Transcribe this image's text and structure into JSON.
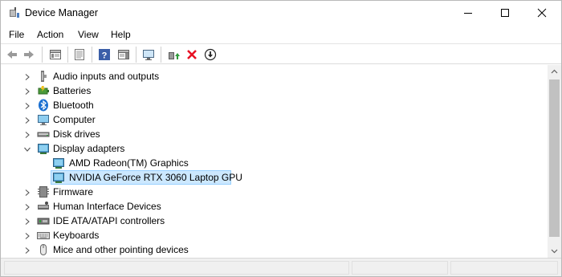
{
  "window": {
    "title": "Device Manager"
  },
  "menu": [
    "File",
    "Action",
    "View",
    "Help"
  ],
  "toolbar": {
    "buttons": [
      "back-icon",
      "forward-icon",
      "console-tree-icon",
      "properties-icon",
      "help-icon",
      "action-pane-icon",
      "monitor-icon",
      "update-driver-icon",
      "uninstall-device-icon",
      "download-icon"
    ]
  },
  "tree": {
    "items": [
      {
        "label": "Audio inputs and outputs",
        "icon": "speaker-icon",
        "level": 1,
        "expander": "collapsed"
      },
      {
        "label": "Batteries",
        "icon": "battery-icon",
        "level": 1,
        "expander": "collapsed"
      },
      {
        "label": "Bluetooth",
        "icon": "bluetooth-icon",
        "level": 1,
        "expander": "collapsed"
      },
      {
        "label": "Computer",
        "icon": "computer-icon",
        "level": 1,
        "expander": "collapsed"
      },
      {
        "label": "Disk drives",
        "icon": "disk-drive-icon",
        "level": 1,
        "expander": "collapsed"
      },
      {
        "label": "Display adapters",
        "icon": "display-adapter-icon",
        "level": 1,
        "expander": "expanded"
      },
      {
        "label": "AMD Radeon(TM) Graphics",
        "icon": "display-adapter-icon",
        "level": 2,
        "expander": "none"
      },
      {
        "label": "NVIDIA GeForce RTX 3060 Laptop GPU",
        "icon": "display-adapter-icon",
        "level": 2,
        "expander": "none",
        "selected": true
      },
      {
        "label": "Firmware",
        "icon": "firmware-icon",
        "level": 1,
        "expander": "collapsed"
      },
      {
        "label": "Human Interface Devices",
        "icon": "hid-icon",
        "level": 1,
        "expander": "collapsed"
      },
      {
        "label": "IDE ATA/ATAPI controllers",
        "icon": "ide-controller-icon",
        "level": 1,
        "expander": "collapsed"
      },
      {
        "label": "Keyboards",
        "icon": "keyboard-icon",
        "level": 1,
        "expander": "collapsed"
      },
      {
        "label": "Mice and other pointing devices",
        "icon": "mouse-icon",
        "level": 1,
        "expander": "collapsed"
      }
    ]
  },
  "colors": {
    "selection_bg": "#cce8ff",
    "selection_border": "#99d1ff",
    "uninstall_red": "#e81123"
  }
}
